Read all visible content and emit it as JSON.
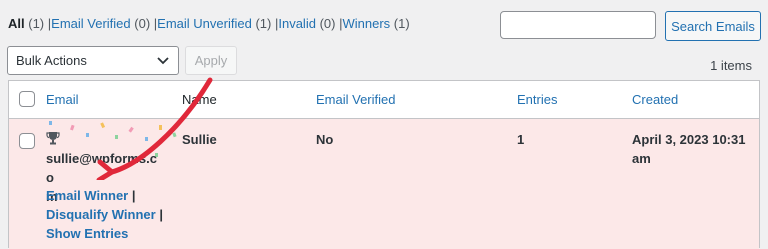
{
  "filters": [
    {
      "label": "All",
      "count": "(1)",
      "current": true
    },
    {
      "label": "Email Verified",
      "count": "(0)"
    },
    {
      "label": "Email Unverified",
      "count": "(1)"
    },
    {
      "label": "Invalid",
      "count": "(0)"
    },
    {
      "label": "Winners",
      "count": "(1)"
    }
  ],
  "search": {
    "button_label": "Search Emails",
    "value": ""
  },
  "bulk": {
    "selected": "Bulk Actions",
    "apply_label": "Apply"
  },
  "items_count": "1 items",
  "table": {
    "columns": [
      "Email",
      "Name",
      "Email Verified",
      "Entries",
      "Created"
    ],
    "rows": [
      {
        "email": "sullie@wpforms.com",
        "email_wrapped_line1": "sullie@wpforms.co",
        "email_wrapped_line2": "m",
        "name": "Sullie",
        "email_verified": "No",
        "entries": "1",
        "created_line1": "April 3, 2023 10:31",
        "created_line2": "am",
        "actions": [
          "Email Winner",
          "Disqualify Winner",
          "Show Entries"
        ]
      }
    ]
  },
  "colors": {
    "link": "#2271b1",
    "winner_row_bg": "#fce8e8",
    "annotation_arrow": "#e0283a"
  },
  "icons": {
    "trophy": "trophy-icon",
    "dropdown": "chevron-down-icon"
  }
}
